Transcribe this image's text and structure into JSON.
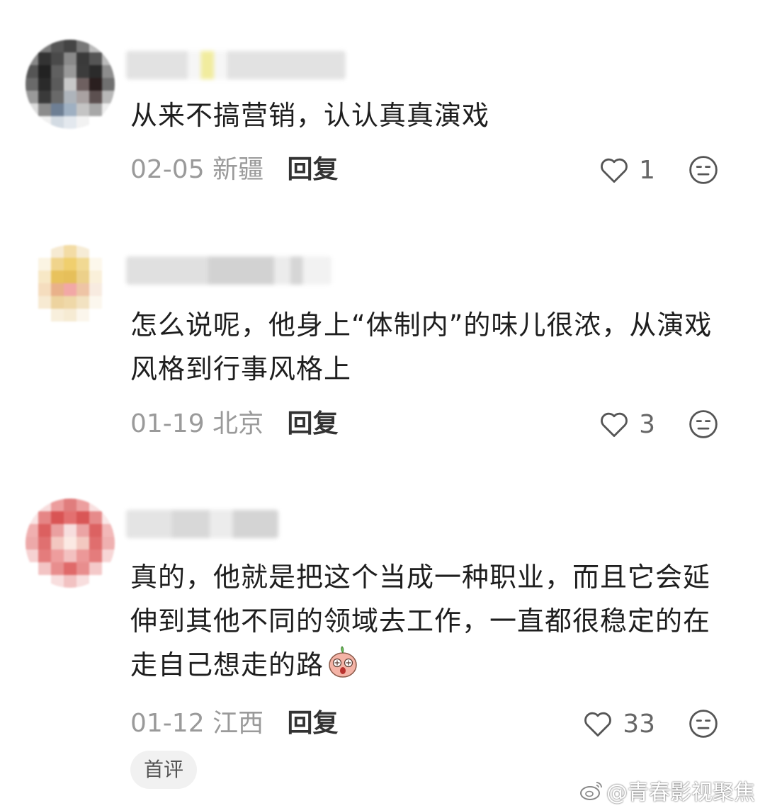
{
  "reply_label": "回复",
  "comments": [
    {
      "text": "从来不搞营销，认认真真演戏",
      "date": "02-05",
      "location": "新疆",
      "likes": "1"
    },
    {
      "text": "怎么说呢，他身上“体制内”的味儿很浓，从演戏风格到行事风格上",
      "date": "01-19",
      "location": "北京",
      "likes": "3"
    },
    {
      "text": "真的，他就是把这个当成一种职业，而且它会延伸到其他不同的领域去工作，一直都很稳定的在走自己想走的路",
      "date": "01-12",
      "location": "江西",
      "likes": "33"
    }
  ],
  "first_comment_tag": "首评",
  "watermark": "@青春影视聚焦",
  "colors": {
    "meta_gray": "#9a9a9a",
    "text": "#1e1e1e",
    "tag_bg": "#f1f1f1"
  }
}
